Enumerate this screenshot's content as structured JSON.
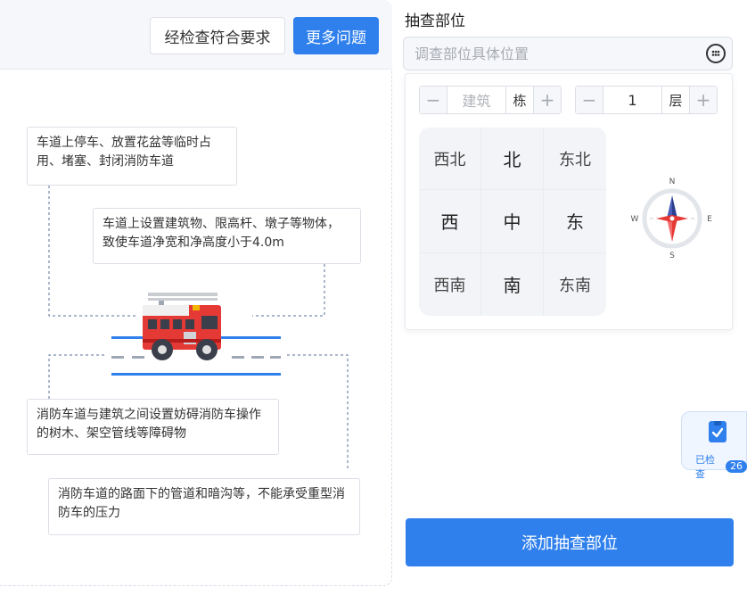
{
  "toolbar": {
    "meets_label": "经检查符合要求",
    "more_label": "更多问题"
  },
  "illustration": {
    "notes": [
      "车道上停车、放置花盆等临时占用、堵塞、封闭消防车道",
      "车道上设置建筑物、限高杆、墩子等物体，致使车道净宽和净高度小于4.0m",
      "消防车道与建筑之间设置妨碍消防车操作的树木、架空管线等障碍物",
      "消防车道的路面下的管道和暗沟等，不能承受重型消防车的压力"
    ],
    "image": "fire-truck-on-road"
  },
  "location": {
    "section_title": "抽查部位",
    "input_placeholder": "调查部位具体位置",
    "input_value": "",
    "keypad_icon": "keypad-icon"
  },
  "building_stepper": {
    "minus": "−",
    "value_placeholder": "建筑",
    "unit": "栋",
    "plus": "+"
  },
  "floor_stepper": {
    "minus": "−",
    "value": "1",
    "unit": "层",
    "plus": "+"
  },
  "directions": [
    "西北",
    "北",
    "东北",
    "西",
    "中",
    "东",
    "西南",
    "南",
    "东南"
  ],
  "compass": {
    "n": "N",
    "s": "S",
    "e": "E",
    "w": "W"
  },
  "checked_badge": {
    "label": "已检查",
    "count": "26",
    "icon": "clipboard-check-icon"
  },
  "actions": {
    "add_location": "添加抽查部位"
  },
  "colors": {
    "primary": "#2f80ed",
    "truck_red": "#e53935",
    "compass_blue": "#2c3e8f"
  }
}
